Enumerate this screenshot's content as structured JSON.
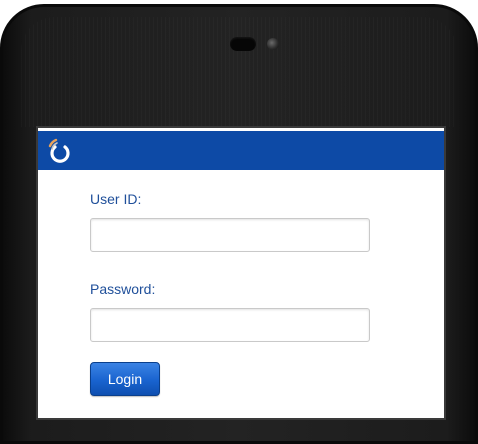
{
  "colors": {
    "header_bg": "#0d4aa6",
    "label_text": "#1f4f9a",
    "button_bg": "#1963cf",
    "device_body": "#1c1c1c"
  },
  "icons": {
    "logo": "circular-arrow-logo-icon"
  },
  "login_form": {
    "userid_label": "User ID:",
    "userid_value": "",
    "password_label": "Password:",
    "password_value": "",
    "login_label": "Login"
  }
}
